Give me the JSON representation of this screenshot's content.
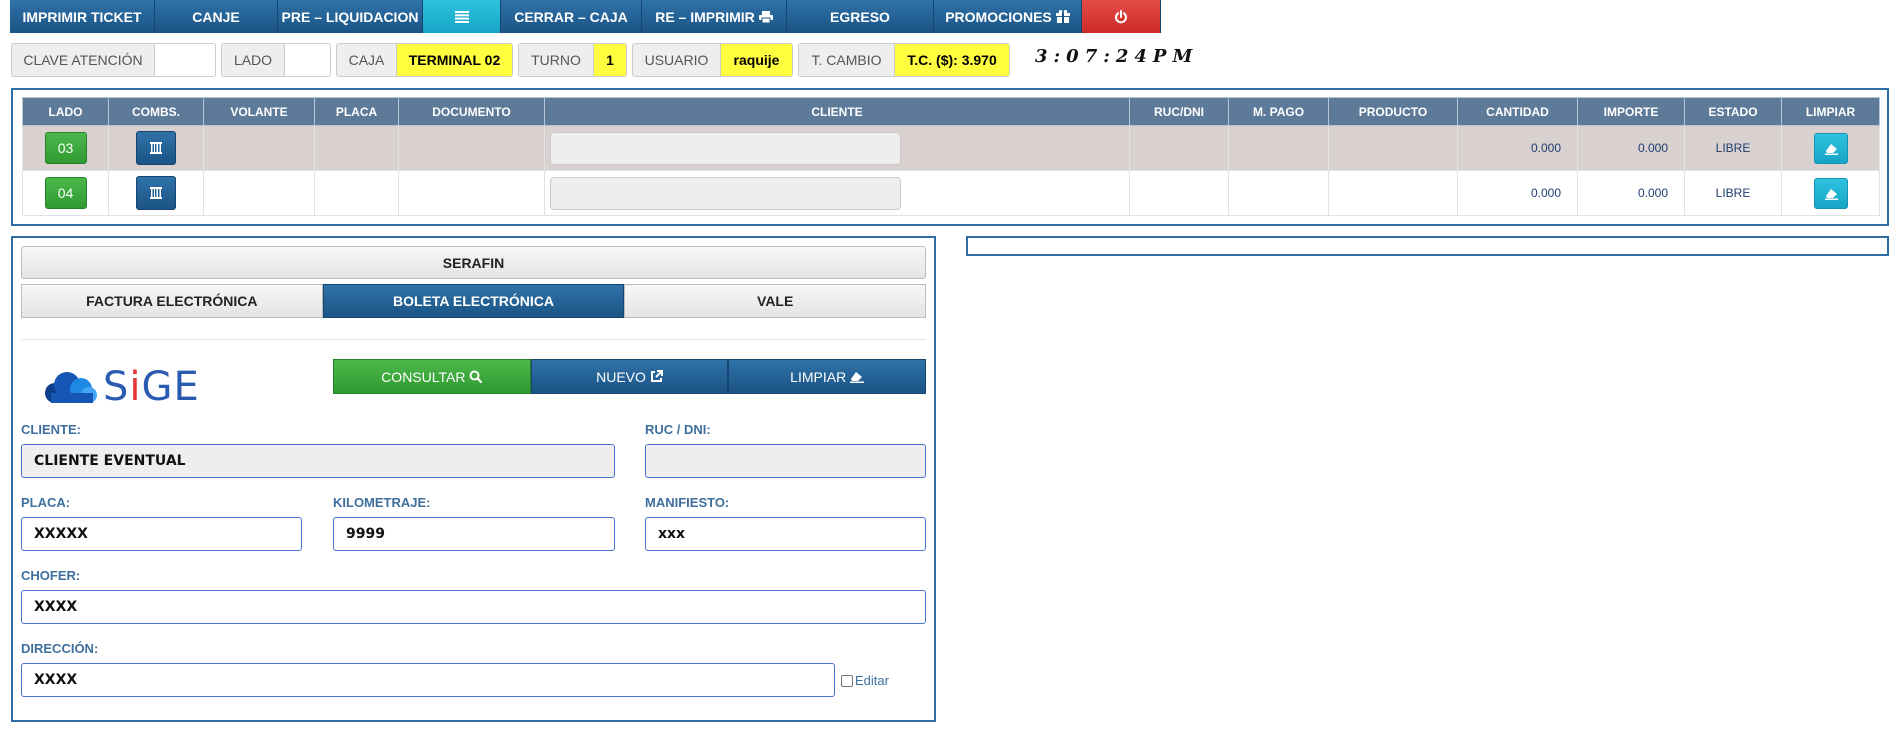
{
  "topmenu": {
    "items": [
      {
        "label": "IMPRIMIR TICKET"
      },
      {
        "label": "CANJE"
      },
      {
        "label": "PRE – LIQUIDACION"
      },
      {
        "label": ""
      },
      {
        "label": "CERRAR – CAJA"
      },
      {
        "label": "RE – IMPRIMIR"
      },
      {
        "label": "EGRESO"
      },
      {
        "label": "PROMOCIONES"
      },
      {
        "label": ""
      }
    ]
  },
  "info": {
    "clave_label": "CLAVE ATENCIÓN",
    "clave_value": "",
    "lado_label": "LADO",
    "lado_value": "",
    "caja_label": "CAJA",
    "caja_value": "TERMINAL 02",
    "turno_label": "TURNO",
    "turno_value": "1",
    "usuario_label": "USUARIO",
    "usuario_value": "raquije",
    "tcambio_label": "T. CAMBIO",
    "tcambio_value": "T.C. ($): 3.970",
    "clock": "3:07:24PM"
  },
  "pumps": {
    "headers": [
      "LADO",
      "COMBS.",
      "VOLANTE",
      "PLACA",
      "DOCUMENTO",
      "CLIENTE",
      "RUC/DNI",
      "M. PAGO",
      "PRODUCTO",
      "CANTIDAD",
      "IMPORTE",
      "ESTADO",
      "LIMPIAR"
    ],
    "rows": [
      {
        "lado": "03",
        "cantidad": "0.000",
        "importe": "0.000",
        "estado": "LIBRE"
      },
      {
        "lado": "04",
        "cantidad": "0.000",
        "importe": "0.000",
        "estado": "LIBRE"
      }
    ]
  },
  "form": {
    "title": "SERAFIN",
    "doc_tabs": [
      "FACTURA ELECTRÓNICA",
      "BOLETA ELECTRÓNICA",
      "VALE"
    ],
    "logo_s": "S",
    "logo_i": "i",
    "logo_rest": "GE",
    "actions": {
      "consultar": "CONSULTAR",
      "nuevo": "NUEVO",
      "limpiar": "LIMPIAR"
    },
    "cliente_label": "CLIENTE:",
    "cliente_value": "CLIENTE EVENTUAL",
    "ruc_label": "RUC / DNI:",
    "ruc_value": "",
    "placa_label": "PLACA:",
    "placa_value": "XXXXX",
    "km_label": "KILOMETRAJE:",
    "km_value": "9999",
    "manifiesto_label": "MANIFIESTO:",
    "manifiesto_value": "xxx",
    "chofer_label": "CHOFER:",
    "chofer_value": "XXXX",
    "direccion_label": "DIRECCIÓN:",
    "direccion_value": "XXXX",
    "editar_label": "Editar"
  },
  "colors": {
    "primary": "#1b5485",
    "cyan": "#16a4c6",
    "red": "#cd2b27",
    "green": "#2f9a2f",
    "yellow": "#ffff40",
    "table_header": "#5e7a99"
  }
}
